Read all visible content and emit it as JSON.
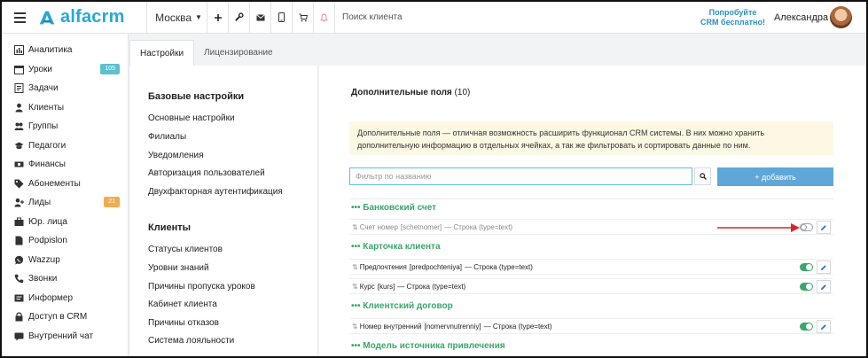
{
  "header": {
    "logo_text": "alfacrm",
    "city": "Москва",
    "search_placeholder": "Поиск клиента",
    "promo_line1": "Попробуйте",
    "promo_line2": "CRM бесплатно!",
    "user_name": "Александра",
    "icons": [
      "menu-icon",
      "plus-icon",
      "wrench-icon",
      "mail-icon",
      "phone-icon",
      "cart-icon",
      "bell-icon"
    ]
  },
  "sidebar": {
    "items": [
      {
        "label": "Аналитика",
        "icon": "chart-icon"
      },
      {
        "label": "Уроки",
        "icon": "calendar-icon",
        "badge": "105",
        "badge_color": "#5bc0d0"
      },
      {
        "label": "Задачи",
        "icon": "tasks-icon"
      },
      {
        "label": "Клиенты",
        "icon": "user-icon"
      },
      {
        "label": "Группы",
        "icon": "users-icon"
      },
      {
        "label": "Педагоги",
        "icon": "graduation-icon"
      },
      {
        "label": "Финансы",
        "icon": "money-icon"
      },
      {
        "label": "Абонементы",
        "icon": "tag-icon"
      },
      {
        "label": "Лиды",
        "icon": "user-plus-icon",
        "badge": "21",
        "badge_color": "#f0ad4e"
      },
      {
        "label": "Юр. лица",
        "icon": "briefcase-icon"
      },
      {
        "label": "Podpislon",
        "icon": "file-icon"
      },
      {
        "label": "Wazzup",
        "icon": "whatsapp-icon"
      },
      {
        "label": "Звонки",
        "icon": "phone-icon"
      },
      {
        "label": "Информер",
        "icon": "informer-icon"
      },
      {
        "label": "Доступ в CRM",
        "icon": "lock-icon"
      },
      {
        "label": "Внутренний чат",
        "icon": "chat-icon"
      }
    ]
  },
  "tabs": [
    {
      "label": "Настройки",
      "active": true
    },
    {
      "label": "Лицензирование",
      "active": false
    }
  ],
  "settings_nav": {
    "sections": [
      {
        "title": "Базовые настройки",
        "links": [
          "Основные настройки",
          "Филиалы",
          "Уведомления",
          "Авторизация пользователей",
          "Двухфакторная аутентификация"
        ]
      },
      {
        "title": "Клиенты",
        "links": [
          "Статусы клиентов",
          "Уровни знаний",
          "Причины пропуска уроков",
          "Кабинет клиента",
          "Причины отказов",
          "Система лояльности"
        ]
      }
    ]
  },
  "main": {
    "title": "Дополнительные поля",
    "count": "(10)",
    "notice_line1": "Дополнительные поля — отличная возможность расширить функционал CRM системы. В них можно хранить",
    "notice_line2": "дополнительную информацию в отдельных ячейках, а так же фильтровать и сортировать данные по ним.",
    "filter_placeholder": "Фильтр по названию",
    "add_button": "+ добавить",
    "groups": [
      {
        "title": "••• Банковский счет",
        "fields": [
          {
            "name": "Счет номер",
            "code": "[schetnomer]",
            "type": "— Строка (type=text)",
            "enabled": false,
            "muted": true
          }
        ]
      },
      {
        "title": "••• Карточка клиента",
        "fields": [
          {
            "name": "Предпочтения",
            "code": "[predpochteniya]",
            "type": "— Строка (type=text)",
            "enabled": true,
            "muted": false
          },
          {
            "name": "Курс",
            "code": "[kurs]",
            "type": "— Строка (type=text)",
            "enabled": true,
            "muted": false
          }
        ]
      },
      {
        "title": "••• Клиентский договор",
        "fields": [
          {
            "name": "Номер внутренний",
            "code": "[nomervnutrenniy]",
            "type": "— Строка (type=text)",
            "enabled": true,
            "muted": false
          }
        ]
      },
      {
        "title": "••• Модель источника привлечения",
        "fields": []
      }
    ]
  },
  "colors": {
    "brand": "#29a8d8",
    "group_green": "#3aa66b",
    "button_blue": "#5ea7d8",
    "arrow_red": "#d9262a",
    "notice_bg": "#fcf8e3"
  }
}
